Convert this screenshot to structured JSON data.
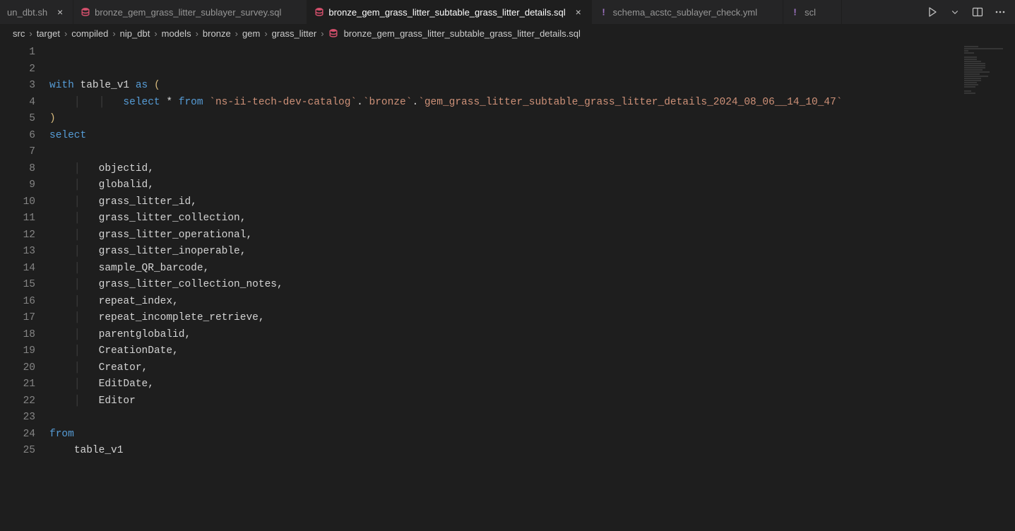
{
  "tabs": [
    {
      "label": "un_dbt.sh",
      "iconType": "none",
      "showClose": true,
      "active": false
    },
    {
      "label": "bronze_gem_grass_litter_sublayer_survey.sql",
      "iconType": "db",
      "showClose": false,
      "active": false
    },
    {
      "label": "bronze_gem_grass_litter_subtable_grass_litter_details.sql",
      "iconType": "db",
      "showClose": true,
      "active": true
    },
    {
      "label": "schema_acstc_sublayer_check.yml",
      "iconType": "bang",
      "showClose": false,
      "active": false
    },
    {
      "label": "scl",
      "iconType": "bang",
      "showClose": false,
      "active": false,
      "truncated": true
    }
  ],
  "breadcrumbs": {
    "parts": [
      "src",
      "target",
      "compiled",
      "nip_dbt",
      "models",
      "bronze",
      "gem",
      "grass_litter"
    ],
    "fileIcon": "db",
    "file": "bronze_gem_grass_litter_subtable_grass_litter_details.sql"
  },
  "code": {
    "lineCount": 25,
    "lines": [
      {
        "n": 1,
        "t": []
      },
      {
        "n": 2,
        "t": []
      },
      {
        "n": 3,
        "t": [
          {
            "c": "kw",
            "v": "with"
          },
          {
            "c": "op",
            "v": " "
          },
          {
            "c": "ident",
            "v": "table_v1"
          },
          {
            "c": "op",
            "v": " "
          },
          {
            "c": "kw",
            "v": "as"
          },
          {
            "c": "op",
            "v": " "
          },
          {
            "c": "yellow",
            "v": "("
          }
        ]
      },
      {
        "n": 4,
        "t": [
          {
            "c": "guide",
            "v": "    │   │   "
          },
          {
            "c": "kw",
            "v": "select"
          },
          {
            "c": "op",
            "v": " "
          },
          {
            "c": "op",
            "v": "*"
          },
          {
            "c": "op",
            "v": " "
          },
          {
            "c": "kw",
            "v": "from"
          },
          {
            "c": "op",
            "v": " "
          },
          {
            "c": "str",
            "v": "`ns-ii-tech-dev-catalog`"
          },
          {
            "c": "op",
            "v": "."
          },
          {
            "c": "str",
            "v": "`bronze`"
          },
          {
            "c": "op",
            "v": "."
          },
          {
            "c": "str",
            "v": "`gem_grass_litter_subtable_grass_litter_details_2024_08_06__14_10_47`"
          }
        ]
      },
      {
        "n": 5,
        "t": [
          {
            "c": "yellow",
            "v": ")"
          }
        ]
      },
      {
        "n": 6,
        "t": [
          {
            "c": "kw",
            "v": "select"
          }
        ]
      },
      {
        "n": 7,
        "t": []
      },
      {
        "n": 8,
        "t": [
          {
            "c": "guide",
            "v": "    │   "
          },
          {
            "c": "ident",
            "v": "objectid"
          },
          {
            "c": "pun",
            "v": ","
          }
        ]
      },
      {
        "n": 9,
        "t": [
          {
            "c": "guide",
            "v": "    │   "
          },
          {
            "c": "ident",
            "v": "globalid"
          },
          {
            "c": "pun",
            "v": ","
          }
        ]
      },
      {
        "n": 10,
        "t": [
          {
            "c": "guide",
            "v": "    │   "
          },
          {
            "c": "ident",
            "v": "grass_litter_id"
          },
          {
            "c": "pun",
            "v": ","
          }
        ]
      },
      {
        "n": 11,
        "t": [
          {
            "c": "guide",
            "v": "    │   "
          },
          {
            "c": "ident",
            "v": "grass_litter_collection"
          },
          {
            "c": "pun",
            "v": ","
          }
        ]
      },
      {
        "n": 12,
        "t": [
          {
            "c": "guide",
            "v": "    │   "
          },
          {
            "c": "ident",
            "v": "grass_litter_operational"
          },
          {
            "c": "pun",
            "v": ","
          }
        ]
      },
      {
        "n": 13,
        "t": [
          {
            "c": "guide",
            "v": "    │   "
          },
          {
            "c": "ident",
            "v": "grass_litter_inoperable"
          },
          {
            "c": "pun",
            "v": ","
          }
        ]
      },
      {
        "n": 14,
        "t": [
          {
            "c": "guide",
            "v": "    │   "
          },
          {
            "c": "ident",
            "v": "sample_QR_barcode"
          },
          {
            "c": "pun",
            "v": ","
          }
        ]
      },
      {
        "n": 15,
        "t": [
          {
            "c": "guide",
            "v": "    │   "
          },
          {
            "c": "ident",
            "v": "grass_litter_collection_notes"
          },
          {
            "c": "pun",
            "v": ","
          }
        ]
      },
      {
        "n": 16,
        "t": [
          {
            "c": "guide",
            "v": "    │   "
          },
          {
            "c": "ident",
            "v": "repeat_index"
          },
          {
            "c": "pun",
            "v": ","
          }
        ]
      },
      {
        "n": 17,
        "t": [
          {
            "c": "guide",
            "v": "    │   "
          },
          {
            "c": "ident",
            "v": "repeat_incomplete_retrieve"
          },
          {
            "c": "pun",
            "v": ","
          }
        ]
      },
      {
        "n": 18,
        "t": [
          {
            "c": "guide",
            "v": "    │   "
          },
          {
            "c": "ident",
            "v": "parentglobalid"
          },
          {
            "c": "pun",
            "v": ","
          }
        ]
      },
      {
        "n": 19,
        "t": [
          {
            "c": "guide",
            "v": "    │   "
          },
          {
            "c": "ident",
            "v": "CreationDate"
          },
          {
            "c": "pun",
            "v": ","
          }
        ]
      },
      {
        "n": 20,
        "t": [
          {
            "c": "guide",
            "v": "    │   "
          },
          {
            "c": "ident",
            "v": "Creator"
          },
          {
            "c": "pun",
            "v": ","
          }
        ]
      },
      {
        "n": 21,
        "t": [
          {
            "c": "guide",
            "v": "    │   "
          },
          {
            "c": "ident",
            "v": "EditDate"
          },
          {
            "c": "pun",
            "v": ","
          }
        ]
      },
      {
        "n": 22,
        "t": [
          {
            "c": "guide",
            "v": "    │   "
          },
          {
            "c": "ident",
            "v": "Editor"
          }
        ]
      },
      {
        "n": 23,
        "t": []
      },
      {
        "n": 24,
        "t": [
          {
            "c": "kw",
            "v": "from"
          }
        ]
      },
      {
        "n": 25,
        "t": [
          {
            "c": "guide",
            "v": "    "
          },
          {
            "c": "ident",
            "v": "table_v1"
          }
        ]
      }
    ]
  },
  "icons": {
    "close": "×",
    "chevron": "›"
  }
}
